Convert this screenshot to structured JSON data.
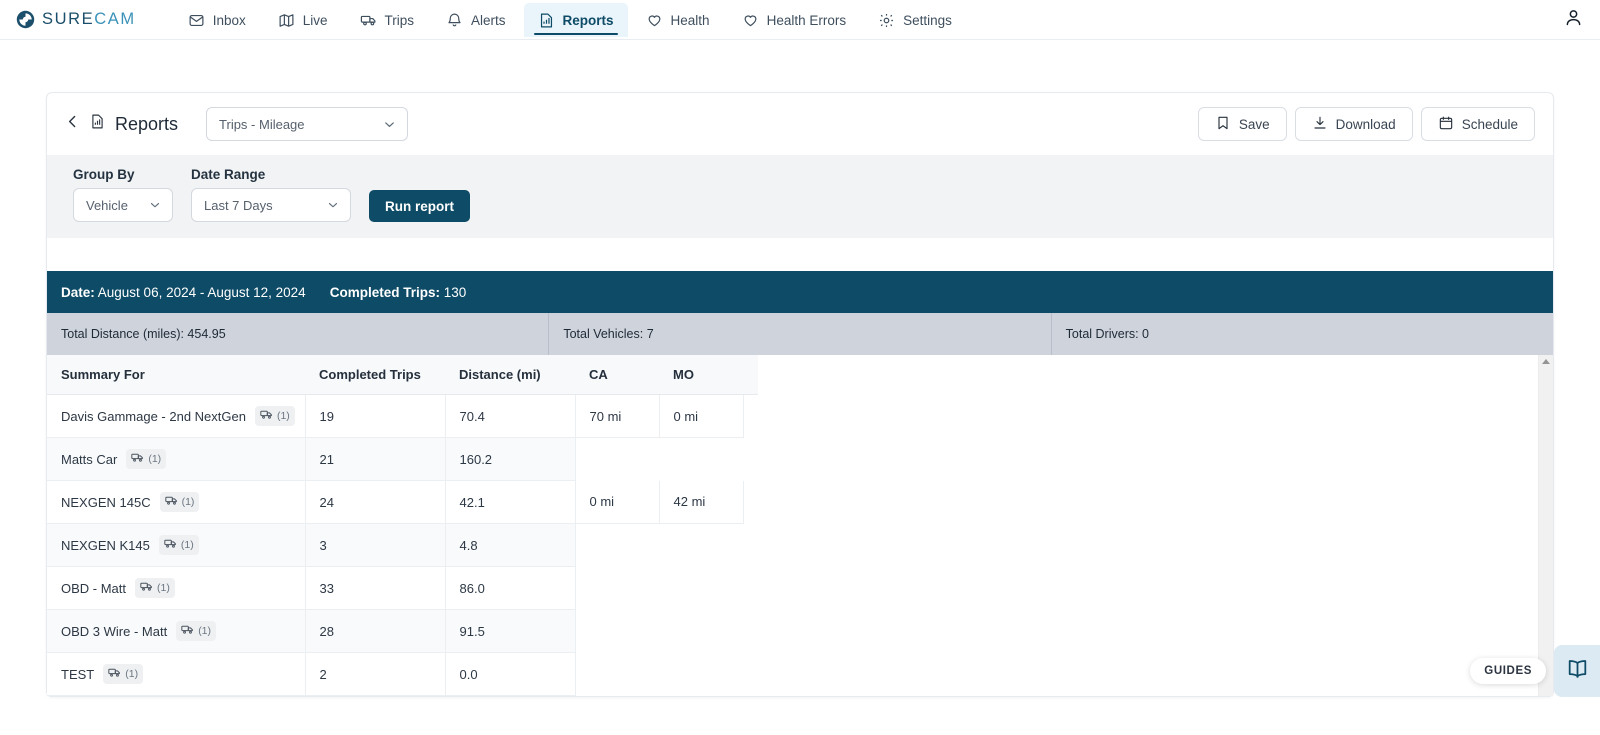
{
  "brand": {
    "sure": "SURE",
    "cam": "CAM",
    "logo_icon": "surecam-logo-icon"
  },
  "nav": {
    "items": [
      {
        "label": "Inbox",
        "icon": "inbox-icon",
        "active": false
      },
      {
        "label": "Live",
        "icon": "map-icon",
        "active": false
      },
      {
        "label": "Trips",
        "icon": "truck-icon",
        "active": false
      },
      {
        "label": "Alerts",
        "icon": "bell-icon",
        "active": false
      },
      {
        "label": "Reports",
        "icon": "report-chart-icon",
        "active": true
      },
      {
        "label": "Health",
        "icon": "heart-icon",
        "active": false
      },
      {
        "label": "Health Errors",
        "icon": "heart-icon",
        "active": false
      },
      {
        "label": "Settings",
        "icon": "gear-icon",
        "active": false
      }
    ],
    "avatar_icon": "user-icon"
  },
  "header": {
    "back_icon": "chevron-left-icon",
    "title_icon": "report-doc-icon",
    "title": "Reports",
    "report_select": {
      "value": "Trips - Mileage",
      "chevron": "chevron-down-icon"
    },
    "actions": [
      {
        "label": "Save",
        "icon": "bookmark-icon"
      },
      {
        "label": "Download",
        "icon": "download-icon"
      },
      {
        "label": "Schedule",
        "icon": "calendar-icon"
      }
    ]
  },
  "filters": {
    "group_by": {
      "label": "Group By",
      "value": "Vehicle",
      "chevron": "chevron-down-icon"
    },
    "date_range": {
      "label": "Date Range",
      "value": "Last 7 Days",
      "chevron": "chevron-down-icon"
    },
    "run_label": "Run report"
  },
  "summary": {
    "date_label": "Date:",
    "date_value": "August 06, 2024 - August 12, 2024",
    "trips_label": "Completed Trips:",
    "trips_value": "130",
    "stats": [
      "Total Distance (miles): 454.95",
      "Total Vehicles: 7",
      "Total Drivers: 0"
    ]
  },
  "table": {
    "columns": [
      "Summary For",
      "Completed Trips",
      "Distance (mi)",
      "CA",
      "MO"
    ],
    "rows": [
      {
        "name": "Davis Gammage - 2nd NextGen",
        "vehicles": "(1)",
        "trips": "19",
        "distance": "70.4",
        "ca": "70 mi",
        "mo": "0 mi"
      },
      {
        "name": "Matts Car",
        "vehicles": "(1)",
        "trips": "21",
        "distance": "160.2",
        "ca": "",
        "mo": ""
      },
      {
        "name": "NEXGEN 145C",
        "vehicles": "(1)",
        "trips": "24",
        "distance": "42.1",
        "ca": "0 mi",
        "mo": "42 mi"
      },
      {
        "name": "NEXGEN K145",
        "vehicles": "(1)",
        "trips": "3",
        "distance": "4.8",
        "ca": "",
        "mo": ""
      },
      {
        "name": "OBD - Matt",
        "vehicles": "(1)",
        "trips": "33",
        "distance": "86.0",
        "ca": "",
        "mo": ""
      },
      {
        "name": "OBD 3 Wire - Matt",
        "vehicles": "(1)",
        "trips": "28",
        "distance": "91.5",
        "ca": "",
        "mo": ""
      },
      {
        "name": "TEST",
        "vehicles": "(1)",
        "trips": "2",
        "distance": "0.0",
        "ca": "",
        "mo": ""
      }
    ],
    "vehicle_icon": "truck-icon"
  },
  "guides": {
    "label": "GUIDES",
    "icon": "open-book-icon"
  },
  "colors": {
    "brand_dark": "#0d4b66",
    "brand_light": "#3b92b8",
    "active_tab_bg": "#e9f4fb",
    "stats_bg": "#ced3dc",
    "filter_bg": "#f1f3f4"
  }
}
